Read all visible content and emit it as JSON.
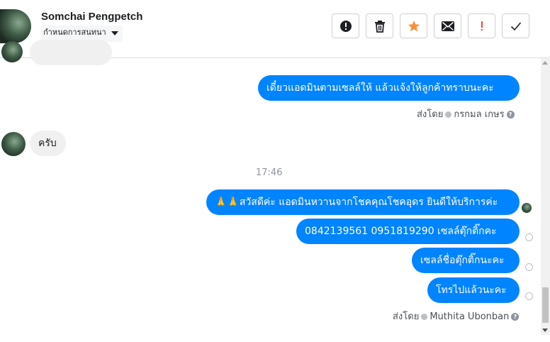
{
  "header": {
    "contact_name": "Somchai Pengpetch",
    "assign_label": "กำหนดการสนทนา"
  },
  "toolbar": {
    "buttons": [
      {
        "name": "mark-spam",
        "icon": "alert-circle-icon"
      },
      {
        "name": "delete",
        "icon": "trash-icon"
      },
      {
        "name": "star",
        "icon": "star-icon",
        "color": "#f7923b"
      },
      {
        "name": "mark-unread",
        "icon": "envelope-icon"
      },
      {
        "name": "follow-up",
        "icon": "exclamation-icon",
        "color": "#fa3e3e"
      },
      {
        "name": "done",
        "icon": "check-icon"
      }
    ]
  },
  "messages": {
    "out_1": "เดี๋ยวแอดมินตามเซลล์ให้ แล้วแจ้งให้ลูกค้าทราบนะคะ",
    "sent_by_1_prefix": "ส่งโดย",
    "sent_by_1_name": "กรกมล เกษร",
    "in_1": "ครับ",
    "timestamp": "17:46",
    "out_2": "🙏🙏สวัสดีค่ะ แอดมินหวานจากโชคคุณโชคอุดร ยินดีให้บริการค่ะ",
    "out_3": "0842139561    0951819290 เซลล์ตุ๊กติ๊กคะ",
    "out_4": "เซลล์ชื่อตุ๊กติ๊กนะคะ",
    "out_5": "โทรไปแล้วนะคะ",
    "sent_by_2_prefix": "ส่งโดย",
    "sent_by_2_name": "Muthita Ubonban"
  },
  "colors": {
    "outgoing_bubble": "#0084ff",
    "incoming_bubble": "#f1f0f0"
  }
}
